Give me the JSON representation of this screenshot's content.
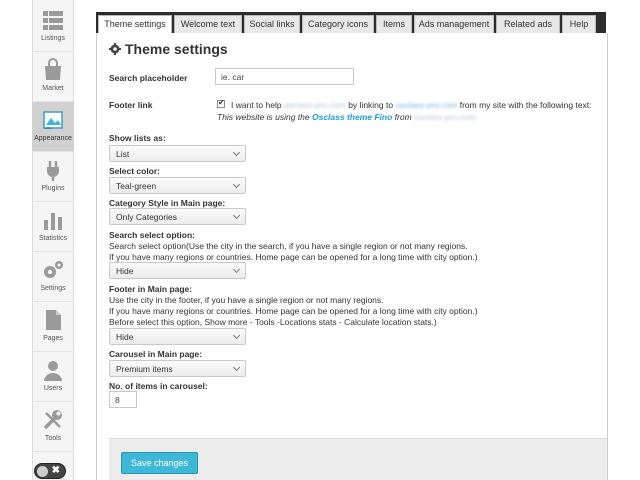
{
  "sidebar": {
    "items": [
      {
        "label": "Listings",
        "icon": "listings-icon"
      },
      {
        "label": "Market",
        "icon": "market-bag-icon"
      },
      {
        "label": "Appearance",
        "icon": "appearance-icon"
      },
      {
        "label": "Plugins",
        "icon": "plug-icon"
      },
      {
        "label": "Statistics",
        "icon": "bar-chart-icon"
      },
      {
        "label": "Settings",
        "icon": "gears-icon"
      },
      {
        "label": "Pages",
        "icon": "pages-icon"
      },
      {
        "label": "Users",
        "icon": "user-icon"
      },
      {
        "label": "Tools",
        "icon": "tools-icon"
      }
    ],
    "toggle_glyph": "✖"
  },
  "tabs": [
    "Theme settings",
    "Welcome text",
    "Social links",
    "Category icons",
    "Items",
    "Ads management",
    "Related ads",
    "Help"
  ],
  "page": {
    "title": "Theme settings",
    "search_placeholder": {
      "label": "Search placeholder",
      "value": "ie. car"
    },
    "footer_link": {
      "label": "Footer link",
      "text_before": "I want to help",
      "blurred_1": "osclass-pro.com",
      "text_mid": "by linking to",
      "blurred_2": "osclass-pro.com",
      "text_after": "from my site with the following text:",
      "line2_before": "This website is using the",
      "line2_brand": "Osclass theme Fino",
      "line2_mid": "from",
      "line2_blurred": "osclass-pro.com"
    },
    "show_lists": {
      "label": "Show lists as:",
      "value": "List"
    },
    "select_color": {
      "label": "Select color:",
      "value": "Teal-green"
    },
    "category_style": {
      "label": "Category Style in Main page:",
      "value": "Only Categories"
    },
    "search_select": {
      "label": "Search select option:",
      "desc1": "Search select option(Use the city in the search, if you have a single region or not many regions.",
      "desc2": "If you have many regions or countries. Home page can be opened for a long time with city option.)",
      "value": "Hide"
    },
    "footer_main": {
      "label": "Footer in Main page:",
      "desc1": "Use the city in the footer, if you have a single region or not many regions.",
      "desc2": "If you have many regions or countries. Home page can be opened for a long time with city option.)",
      "desc3": "Before select this option, Show more - Tools -Locations stats - Calculate location stats.)",
      "value": "Hide"
    },
    "carousel": {
      "label": "Carousel in Main page:",
      "value": "Premium items"
    },
    "items_in_carousel": {
      "label": "No. of items in carousel:",
      "value": "8"
    },
    "save_label": "Save changes"
  },
  "colors": {
    "accent": "#3fb8d8",
    "brand_link": "#1a9fd8",
    "tabbar": "#2c2c2c"
  }
}
